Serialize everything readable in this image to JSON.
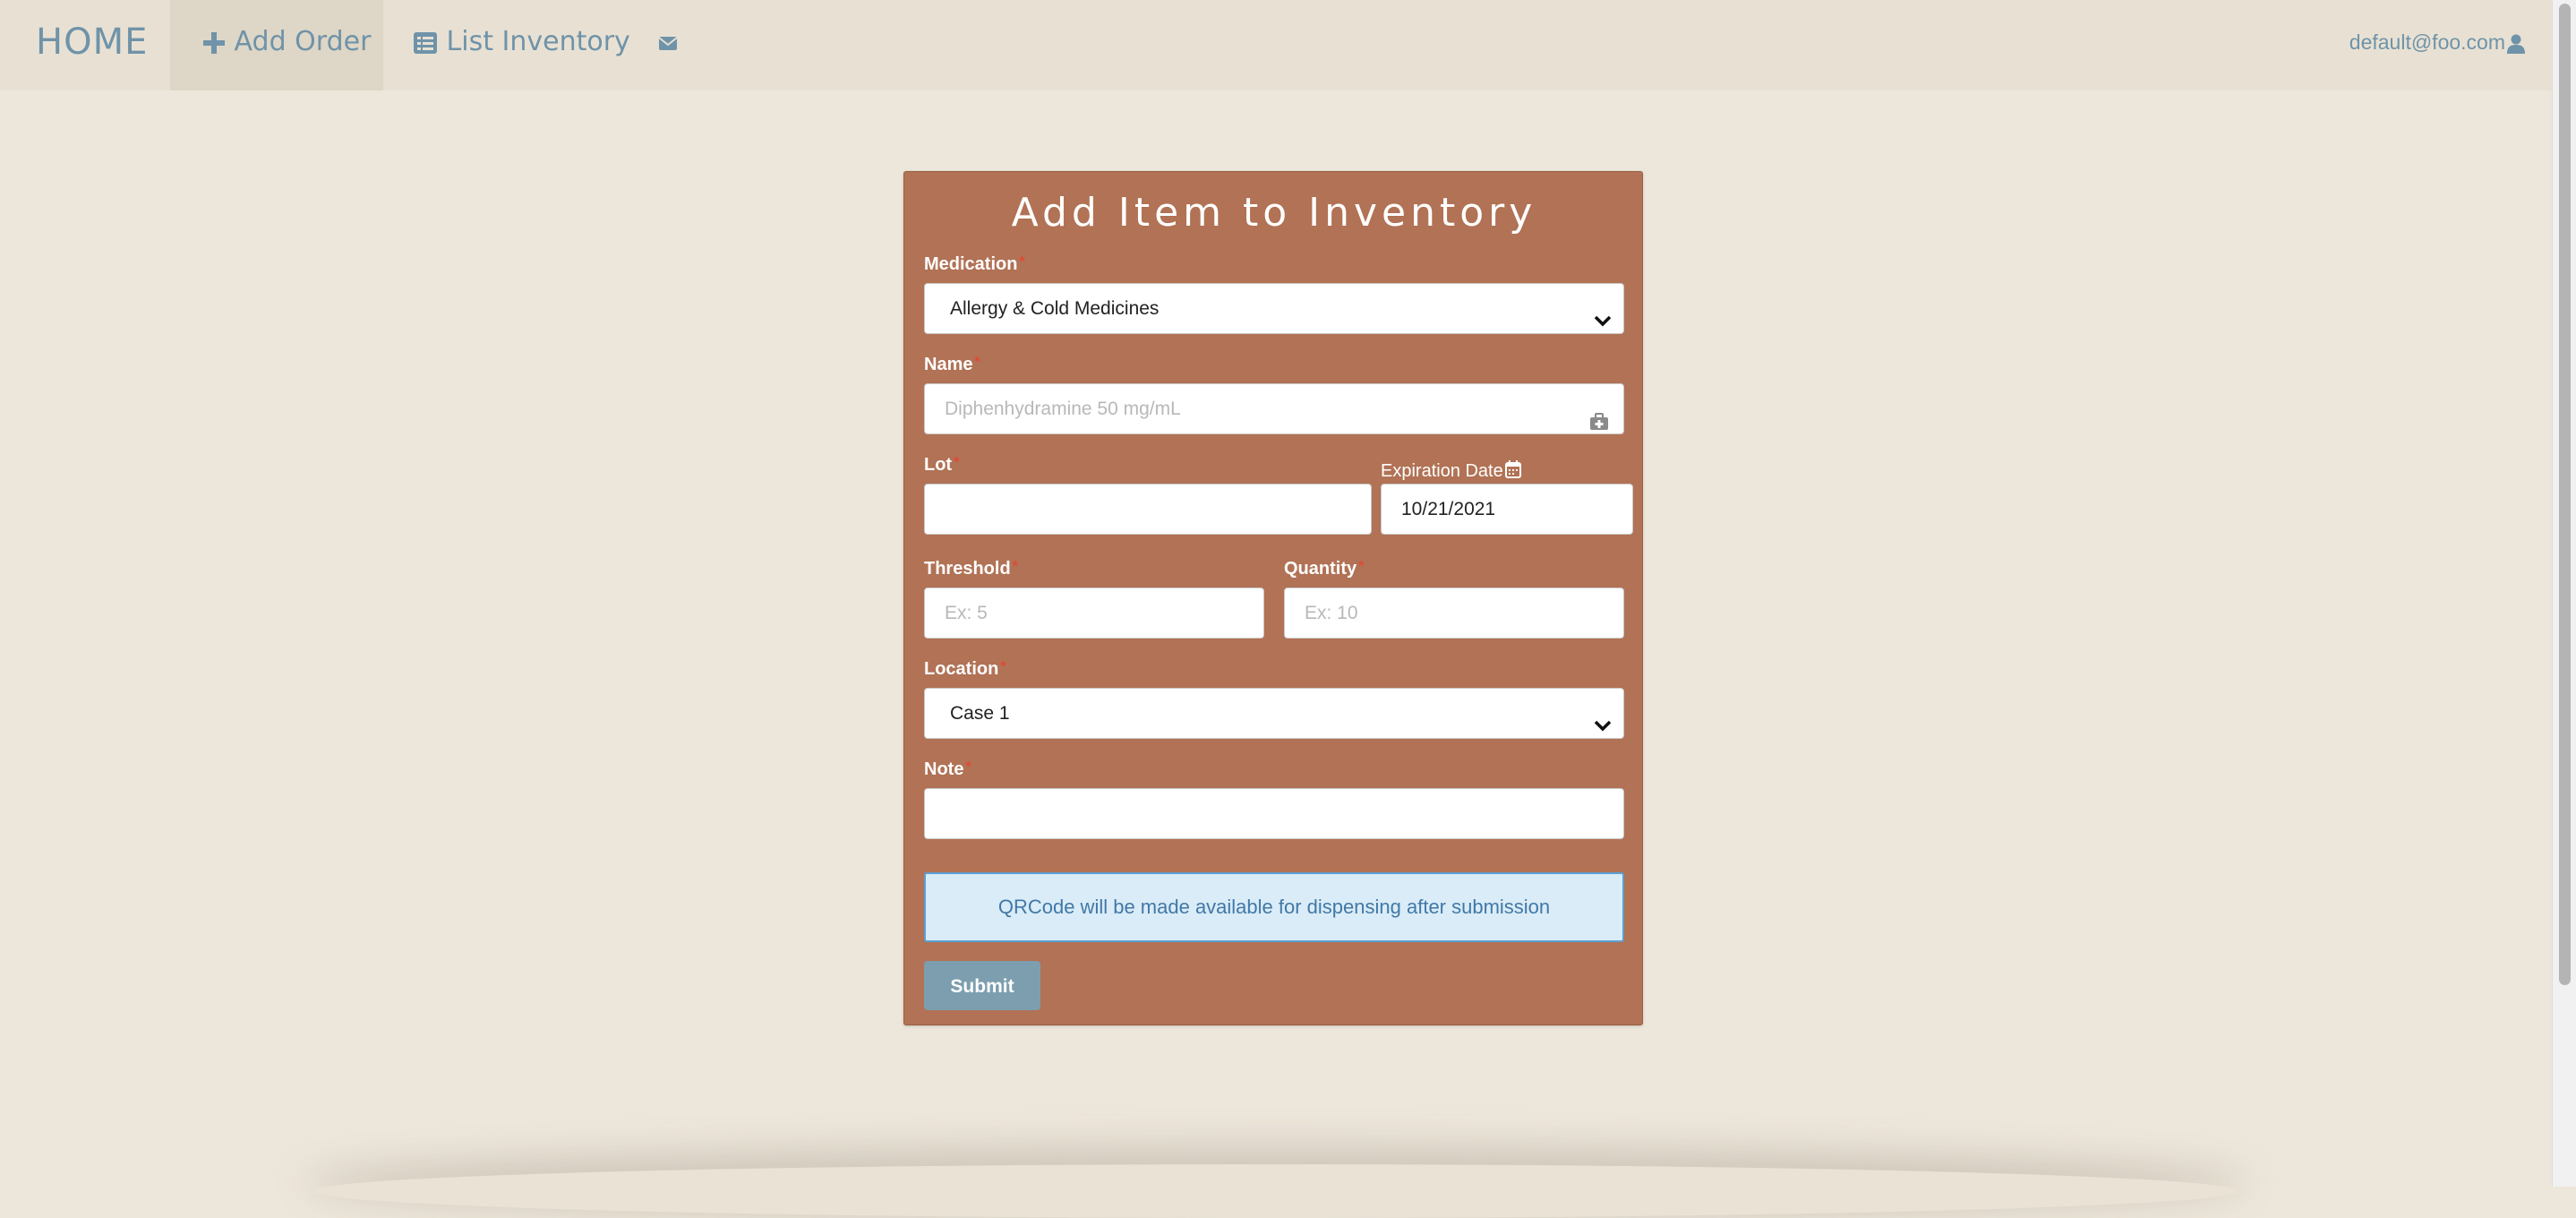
{
  "nav": {
    "home": "HOME",
    "add_order": "Add Order",
    "list_inventory": "List Inventory",
    "user_email": "default@foo.com"
  },
  "form": {
    "title": "Add Item to Inventory",
    "medication": {
      "label": "Medication",
      "value": "Allergy & Cold Medicines"
    },
    "name": {
      "label": "Name",
      "placeholder": "Diphenhydramine 50 mg/mL"
    },
    "lot": {
      "label": "Lot",
      "value": ""
    },
    "expiration": {
      "label": "Expiration Date",
      "value": "10/21/2021"
    },
    "threshold": {
      "label": "Threshold",
      "placeholder": "Ex: 5"
    },
    "quantity": {
      "label": "Quantity",
      "placeholder": "Ex: 10"
    },
    "location": {
      "label": "Location",
      "value": "Case 1"
    },
    "note": {
      "label": "Note",
      "value": ""
    },
    "info": "QRCode will be made available for dispensing after submission",
    "submit": "Submit",
    "required_mark": "*"
  },
  "icons": {
    "add_order": "plus-icon",
    "list_inventory": "list-icon",
    "mail": "envelope-icon",
    "user": "user-icon",
    "name_field": "medkit-icon",
    "expiration": "calendar-icon",
    "select": "chevron-down-icon"
  },
  "colors": {
    "panel": "#b17255",
    "nav_text": "#6f93a9",
    "required": "#e04a36",
    "info_bg": "#d9ecf7",
    "info_text": "#4278a7",
    "submit": "#7d9eaf"
  }
}
